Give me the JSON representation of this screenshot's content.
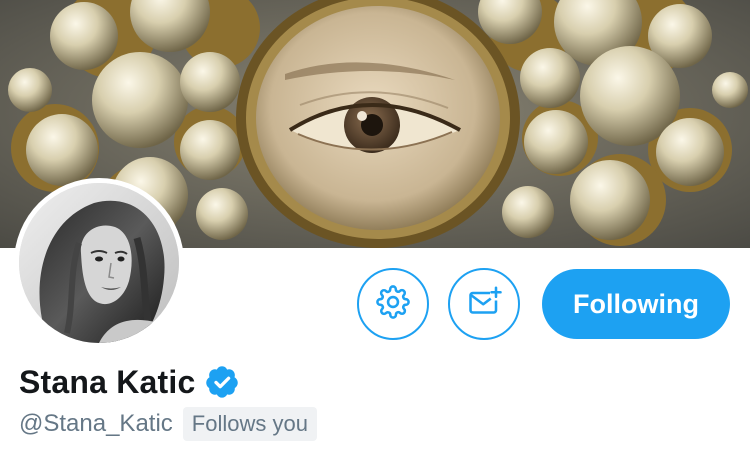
{
  "profile": {
    "display_name": "Stana Katic",
    "handle": "@Stana_Katic",
    "follows_you_label": "Follows you",
    "verified": true
  },
  "actions": {
    "settings_icon": "gear-icon",
    "message_icon": "new-message-icon",
    "follow_state_label": "Following"
  },
  "colors": {
    "accent": "#1da1f2",
    "name_text": "#14171a",
    "secondary_text": "#657786",
    "badge_bg": "#f0f2f4"
  }
}
